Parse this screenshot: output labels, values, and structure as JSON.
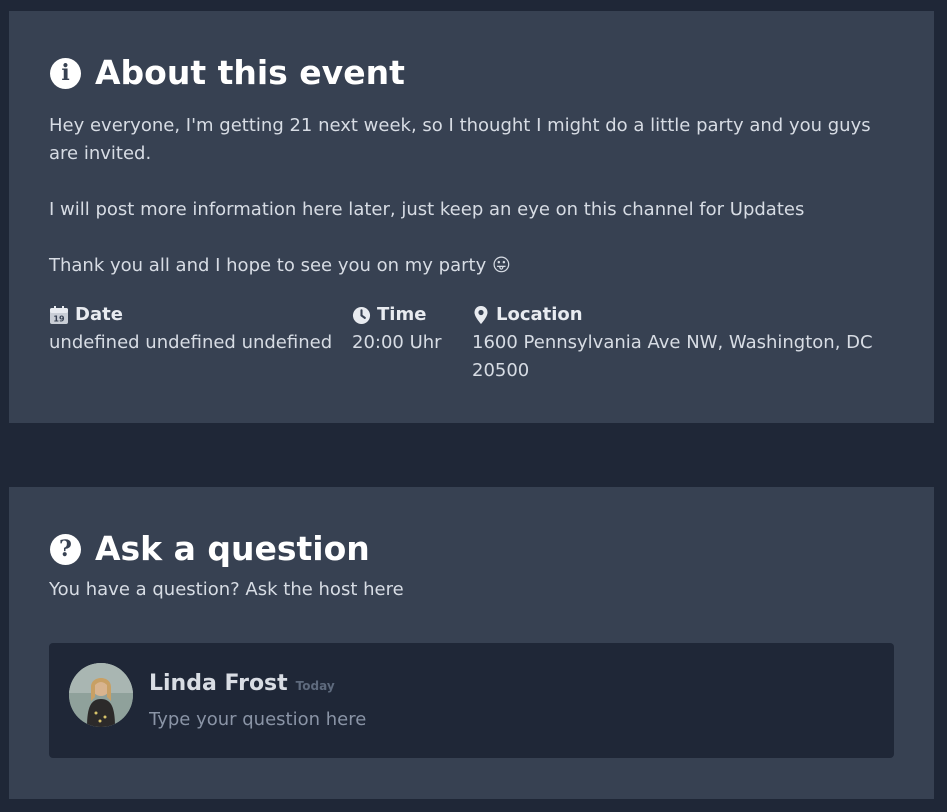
{
  "about": {
    "title": "About this event",
    "paragraphs": [
      "Hey everyone, I'm getting 21 next week, so I thought I might do a little party and you guys are invited.",
      "I will post more information here later, just keep an eye on this channel for Updates",
      "Thank you all and I hope to see you on my party 😛"
    ],
    "date": {
      "label": "Date",
      "value": "undefined undefined undefined",
      "icon": "calendar-icon"
    },
    "time": {
      "label": "Time",
      "value": "20:00 Uhr",
      "icon": "clock-icon"
    },
    "location": {
      "label": "Location",
      "value": "1600 Pennsylvania Ave NW, Washington, DC 20500",
      "icon": "map-pin-icon"
    }
  },
  "ask": {
    "title": "Ask a question",
    "subtitle": "You have a question? Ask the host here",
    "user_name": "Linda Frost",
    "timestamp": "Today",
    "placeholder": "Type your question here"
  },
  "colors": {
    "page_bg": "#1f2737",
    "card_bg": "#374152",
    "input_bg": "#1f2737"
  }
}
